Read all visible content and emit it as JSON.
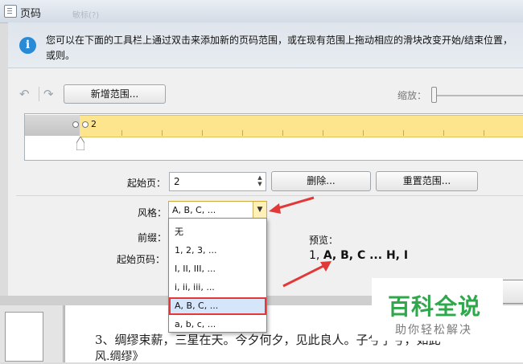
{
  "window": {
    "title": "页码",
    "background_hint": "敏标(?)"
  },
  "info": {
    "text": "您可以在下面的工具栏上通过双击来添加新的页码范围，或在现有范围上拖动相应的滑块改变开始/结束位置，或则。"
  },
  "toolbar": {
    "undo_icon": "undo-icon",
    "redo_icon": "redo-icon",
    "add_range_label": "新增范围...",
    "zoom_label": "缩放："
  },
  "range": {
    "start_label": "2"
  },
  "form": {
    "start_page_label": "起始页：",
    "start_page_value": "2",
    "delete_label": "删除...",
    "reset_label": "重置范围...",
    "style_label": "风格：",
    "style_value": "A, B, C, ...",
    "prefix_label": "前缀：",
    "start_number_label": "起始页码：",
    "preview_label": "预览：",
    "preview_first": "1, ",
    "preview_rest": "A, B, C ... H, I"
  },
  "dropdown": {
    "options": [
      "无",
      "1, 2, 3, ...",
      "I, II, III, ...",
      "i, ii, iii, ...",
      "A, B, C, ...",
      "a, b, c, ..."
    ],
    "selected_index": 4
  },
  "document": {
    "line1": "3、绸缪束薪，三星在天。今夕何夕，见此良人。子兮子兮，如此",
    "line2": "风.绸缪》"
  },
  "watermark": {
    "logo": "百科全说",
    "sub": "助你轻松解决"
  },
  "colors": {
    "range_fill": "#fde58e",
    "selected_outline": "#e23838",
    "annotation_arrow": "#e23838",
    "watermark_green": "#2ea84a"
  }
}
